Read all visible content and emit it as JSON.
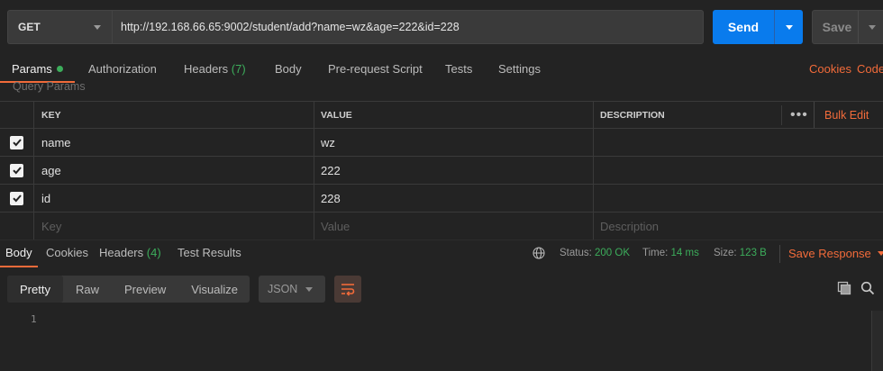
{
  "request": {
    "method": "GET",
    "url": "http://192.168.66.65:9002/student/add?name=wz&age=222&id=228",
    "send_label": "Send",
    "save_label": "Save"
  },
  "tabs": {
    "params": "Params",
    "authorization": "Authorization",
    "headers": "Headers",
    "headers_count": "(7)",
    "body": "Body",
    "prerequest": "Pre-request Script",
    "tests": "Tests",
    "settings": "Settings",
    "cookies": "Cookies",
    "code": "Code"
  },
  "query_params": {
    "title": "Query Params",
    "columns": {
      "key": "KEY",
      "value": "VALUE",
      "description": "DESCRIPTION"
    },
    "bulk_edit": "Bulk Edit",
    "more": "•••",
    "rows": [
      {
        "checked": true,
        "key": "name",
        "value": "wz",
        "description": ""
      },
      {
        "checked": true,
        "key": "age",
        "value": "222",
        "description": ""
      },
      {
        "checked": true,
        "key": "id",
        "value": "228",
        "description": ""
      }
    ],
    "placeholder": {
      "key": "Key",
      "value": "Value",
      "description": "Description"
    }
  },
  "response": {
    "tabs": {
      "body": "Body",
      "cookies": "Cookies",
      "headers": "Headers",
      "headers_count": "(4)",
      "test_results": "Test Results"
    },
    "status_label": "Status:",
    "status_value": "200 OK",
    "time_label": "Time:",
    "time_value": "14 ms",
    "size_label": "Size:",
    "size_value": "123 B",
    "save_response": "Save Response",
    "views": [
      "Pretty",
      "Raw",
      "Preview",
      "Visualize"
    ],
    "format": "JSON",
    "line_numbers": [
      "1"
    ]
  },
  "colors": {
    "accent": "#f26b3a",
    "send_blue": "#097bed",
    "success_green": "#3cad5b"
  }
}
